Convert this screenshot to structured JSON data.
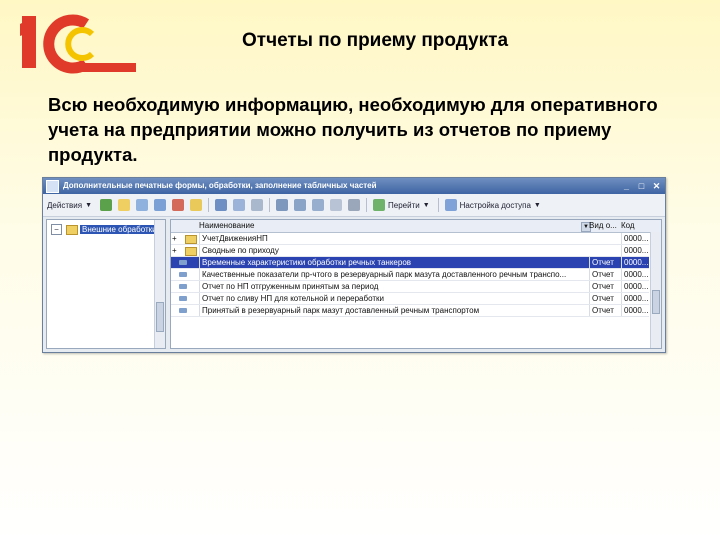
{
  "slide": {
    "title": "Отчеты по приему продукта",
    "body": "Всю необходимую информацию, необходимую для оперативного учета на предприятии можно получить из отчетов по приему продукта."
  },
  "colors": {
    "brand_red": "#e03a2a",
    "brand_yellow": "#f5c400",
    "selection": "#2a43b0"
  },
  "window": {
    "title": "Дополнительные печатные формы, обработки, заполнение табличных частей",
    "toolbar": {
      "actions_label": "Действия",
      "go_label": "Перейти",
      "access_label": "Настройка доступа"
    },
    "tree": {
      "root_label": "Внешние обработки",
      "expander": "−"
    },
    "list": {
      "headers": {
        "name": "Наименование",
        "type": "Вид о...",
        "code": "Код"
      },
      "rows": [
        {
          "kind": "folder",
          "name": "УчетДвиженияНП",
          "type": "",
          "code": "0000..."
        },
        {
          "kind": "folder",
          "name": "Сводные по приходу",
          "type": "",
          "code": "0000..."
        },
        {
          "kind": "doc",
          "name": "Временные характеристики обработки речных танкеров",
          "type": "Отчет",
          "code": "0000...",
          "selected": true
        },
        {
          "kind": "doc",
          "name": "Качественные показатели пр-чтого в резервуарный парк мазута доставленного речным транспо...",
          "type": "Отчет",
          "code": "0000..."
        },
        {
          "kind": "doc",
          "name": "Отчет по НП отгруженным принятым за период",
          "type": "Отчет",
          "code": "0000..."
        },
        {
          "kind": "doc",
          "name": "Отчет по сливу НП для котельной и переработки",
          "type": "Отчет",
          "code": "0000..."
        },
        {
          "kind": "doc",
          "name": "Принятый в резервуарный парк мазут доставленный речным транспортом",
          "type": "Отчет",
          "code": "0000..."
        }
      ]
    }
  }
}
